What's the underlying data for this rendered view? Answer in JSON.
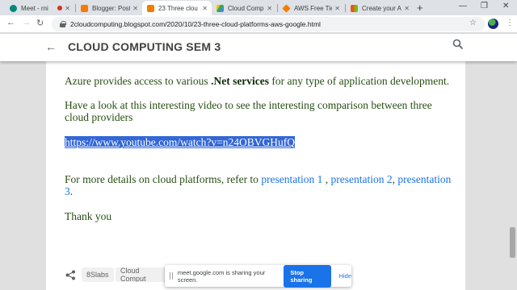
{
  "tabs": [
    {
      "title": "Meet - rni",
      "color": "#00897b",
      "active": false
    },
    {
      "title": "Blogger: Posts",
      "color": "#f57c00",
      "active": false
    },
    {
      "title": "23 Three clou",
      "color": "#f57c00",
      "active": true
    },
    {
      "title": "Cloud Computi",
      "color": "#4285f4",
      "active": false
    },
    {
      "title": "AWS Free Tier",
      "color": "#f57c00",
      "active": false
    },
    {
      "title": "Create your A",
      "color": "#34a853",
      "active": false
    }
  ],
  "address": {
    "url": "2cloudcomputing.blogspot.com/2020/10/23-three-cloud-platforms-aws-google.html"
  },
  "blog": {
    "title": "CLOUD COMPUTING SEM 3"
  },
  "post": {
    "p1_before": "Azure provides access to various ",
    "p1_bold": ".Net services",
    "p1_after": " for any type of application development.",
    "p2": "Have a look at this interesting video to see the interesting comparison between three cloud providers",
    "youtube_link": "https://www.youtube.com/watch?v=n24OBVGHufQ",
    "p3_before": "For more details on cloud platforms, refer to ",
    "link1": "presentation 1",
    "sep1": " , ",
    "link2": "presentation 2",
    "sep2": ",",
    "link3": "presentation 3",
    "p3_after": ".",
    "thanks": "Thank you"
  },
  "labels": [
    "8Slabs",
    "Cloud Comput"
  ],
  "share_bar": {
    "message": "meet.google.com is sharing your screen.",
    "stop": "Stop sharing",
    "hide": "Hide"
  },
  "colors": {
    "text_green": "#274e13",
    "link_blue": "#1a73e8",
    "selection": "#3367d6"
  }
}
